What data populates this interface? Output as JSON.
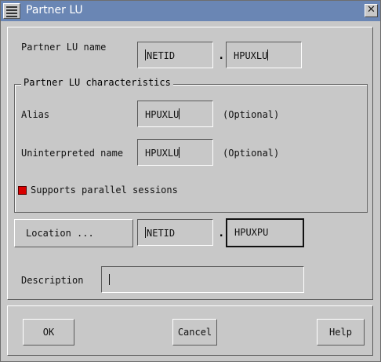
{
  "window": {
    "title": "Partner LU"
  },
  "partner_lu_name": {
    "label": "Partner LU name",
    "netid": "NETID",
    "separator": ".",
    "name": "HPUXLU"
  },
  "characteristics": {
    "group_title": "Partner LU characteristics",
    "alias_label": "Alias",
    "alias_value": "HPUXLU",
    "alias_hint": "(Optional)",
    "uninterpreted_label": "Uninterpreted name",
    "uninterpreted_value": "HPUXLU",
    "uninterpreted_hint": "(Optional)",
    "parallel_sessions_label": "Supports parallel sessions",
    "parallel_sessions_checked": true
  },
  "location": {
    "button_label": "Location ...",
    "netid": "NETID",
    "separator": ".",
    "pu_name": "HPUXPU"
  },
  "description": {
    "label": "Description",
    "value": ""
  },
  "buttons": {
    "ok": "OK",
    "cancel": "Cancel",
    "help": "Help"
  },
  "colors": {
    "titlebar": "#6a86b4",
    "window_bg": "#c8c8c8",
    "checkbox_on": "#d90000"
  }
}
